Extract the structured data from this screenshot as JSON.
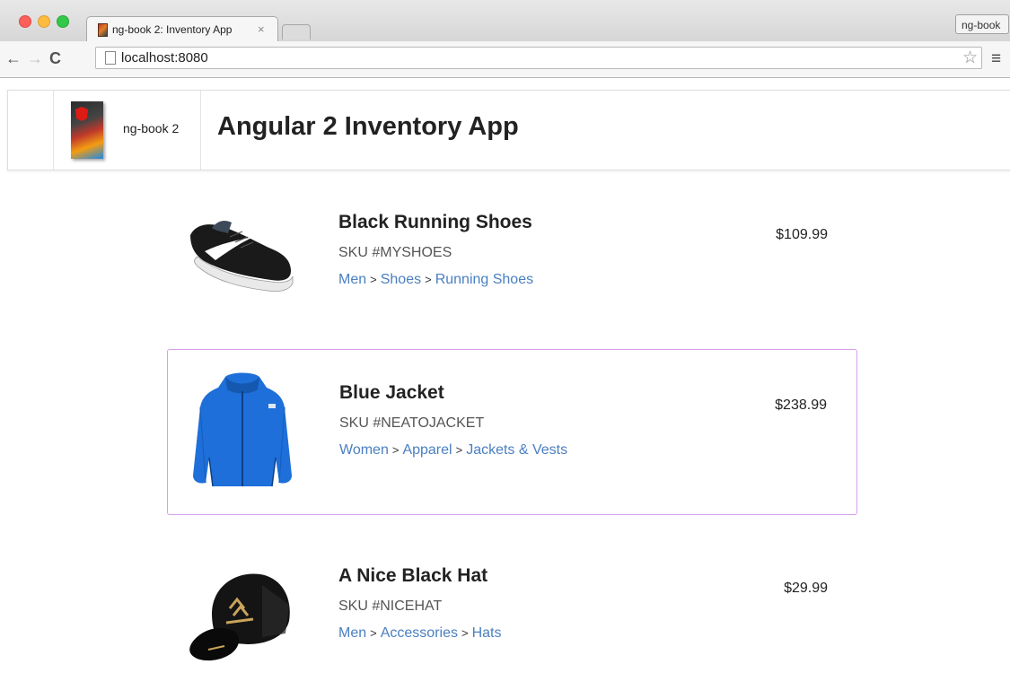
{
  "browser": {
    "tab_title": "ng-book 2: Inventory App",
    "tab_close": "×",
    "profile_label": "ng-book",
    "url": "localhost:8080"
  },
  "header": {
    "brand": "ng-book 2",
    "title": "Angular 2 Inventory App"
  },
  "products": [
    {
      "name": "Black Running Shoes",
      "sku": "SKU #MYSHOES",
      "department": [
        "Men",
        "Shoes",
        "Running Shoes"
      ],
      "price": "$109.99",
      "image_icon": "shoe-image"
    },
    {
      "name": "Blue Jacket",
      "sku": "SKU #NEATOJACKET",
      "department": [
        "Women",
        "Apparel",
        "Jackets & Vests"
      ],
      "price": "$238.99",
      "image_icon": "jacket-image",
      "selected": true,
      "selected_border_color": "#d7a0ee"
    },
    {
      "name": "A Nice Black Hat",
      "sku": "SKU #NICEHAT",
      "department": [
        "Men",
        "Accessories",
        "Hats"
      ],
      "price": "$29.99",
      "image_icon": "hat-image"
    }
  ],
  "colors": {
    "link": "#4a7fc1",
    "text": "#222222"
  },
  "breadcrumb_separator": ">"
}
